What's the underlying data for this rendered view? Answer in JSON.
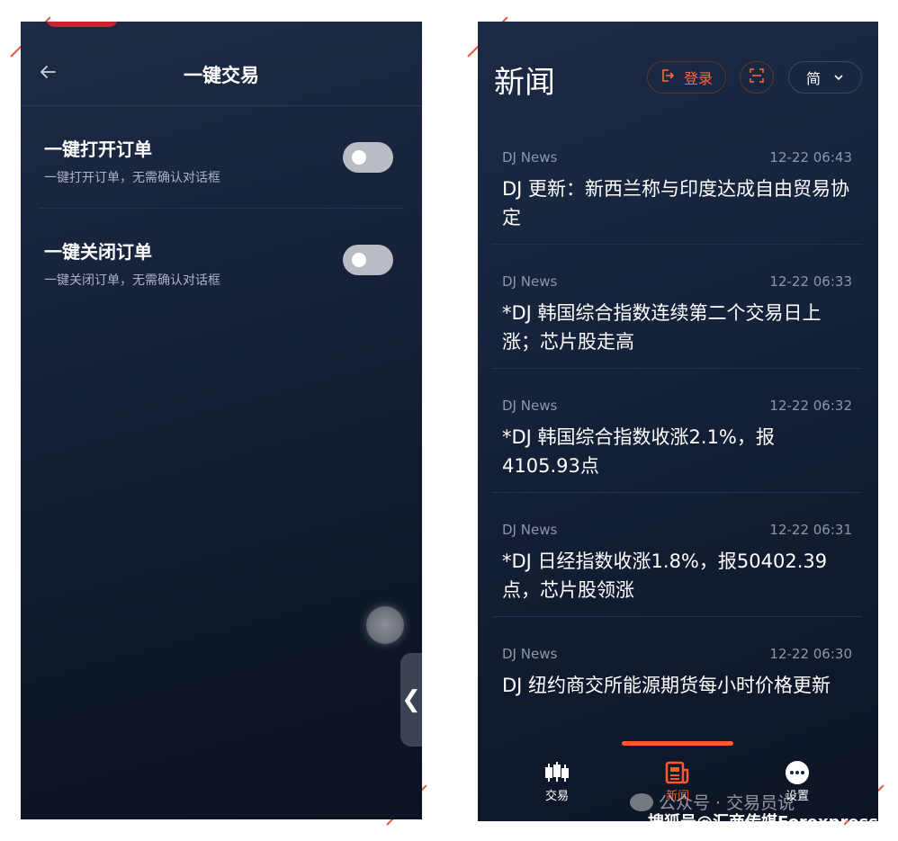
{
  "left_screen": {
    "header": {
      "title": "一键交易",
      "back_icon": "arrow-left-icon"
    },
    "settings": [
      {
        "title": "一键打开订单",
        "description": "一键打开订单，无需确认对话框",
        "enabled": false
      },
      {
        "title": "一键关闭订单",
        "description": "一键关闭订单，无需确认对话框",
        "enabled": false
      }
    ],
    "edge_handle_glyph": "❮"
  },
  "right_screen": {
    "header": {
      "title": "新闻",
      "login_label": "登录",
      "lang_label": "简"
    },
    "news": [
      {
        "source": "DJ News",
        "time": "12-22 06:43",
        "headline": "DJ 更新：新西兰称与印度达成自由贸易协定"
      },
      {
        "source": "DJ News",
        "time": "12-22 06:33",
        "headline": "*DJ 韩国综合指数连续第二个交易日上涨；芯片股走高"
      },
      {
        "source": "DJ News",
        "time": "12-22 06:32",
        "headline": "*DJ 韩国综合指数收涨2.1%，报4105.93点"
      },
      {
        "source": "DJ News",
        "time": "12-22 06:31",
        "headline": "*DJ 日经指数收涨1.8%，报50402.39点，芯片股领涨"
      },
      {
        "source": "DJ News",
        "time": "12-22 06:30",
        "headline": "DJ 纽约商交所能源期货每小时价格更新"
      }
    ],
    "bottom_nav": [
      {
        "label": "交易",
        "icon": "candlestick-icon",
        "active": false
      },
      {
        "label": "新闻",
        "icon": "newspaper-icon",
        "active": true
      },
      {
        "label": "设置",
        "icon": "more-dots-icon",
        "active": false
      }
    ]
  },
  "watermark": {
    "line1": "公众号 · 交易员说",
    "line2": "搜狐号@汇商传媒Forexpress"
  },
  "colors": {
    "accent": "#ff5a2c",
    "background": "#0f1829"
  }
}
